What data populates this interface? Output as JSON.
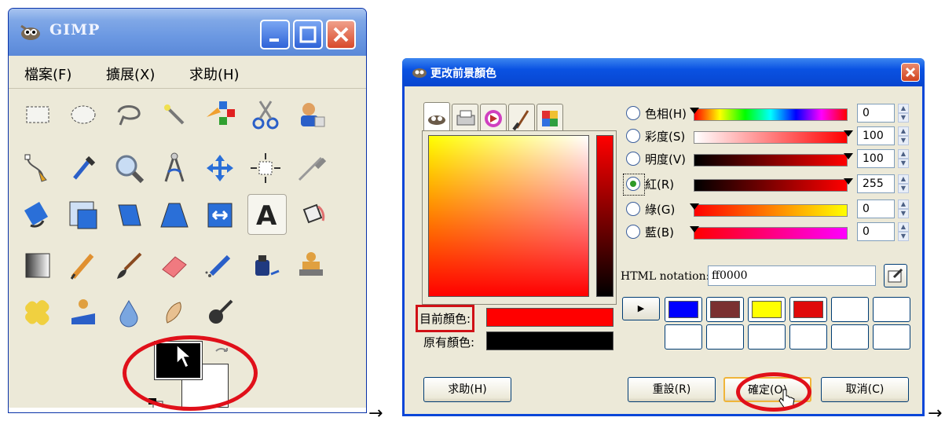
{
  "toolbox": {
    "title": "GIMP",
    "menu": [
      "檔案(F)",
      "擴展(X)",
      "求助(H)"
    ],
    "window_buttons": [
      "minimize-icon",
      "maximize-icon",
      "close-icon"
    ]
  },
  "dialog": {
    "title": "更改前景顏色",
    "tabs": [
      "gimp-selector-icon",
      "cmyk-printer-icon",
      "triangle-wheel-icon",
      "watercolor-brush-icon",
      "scales-icon"
    ],
    "channels": [
      {
        "label": "色相(H)",
        "value": "0",
        "selected": false
      },
      {
        "label": "彩度(S)",
        "value": "100",
        "selected": false
      },
      {
        "label": "明度(V)",
        "value": "100",
        "selected": false
      },
      {
        "label": "紅(R)",
        "value": "255",
        "selected": true
      },
      {
        "label": "綠(G)",
        "value": "0",
        "selected": false
      },
      {
        "label": "藍(B)",
        "value": "0",
        "selected": false
      }
    ],
    "current_color_label": "目前顏色:",
    "old_color_label": "原有顏色:",
    "current_color": "#ff0000",
    "old_color": "#000000",
    "html_notation_label": "HTML notation:",
    "html_notation_value": "ff0000",
    "history_colors": [
      "#0000ff",
      "#7a3030",
      "#ffff00",
      "#e00a0a",
      "#ffffff",
      "#ffffff",
      "#ffffff",
      "#ffffff",
      "#ffffff",
      "#ffffff",
      "#ffffff",
      "#ffffff"
    ],
    "buttons": {
      "help": "求助(H)",
      "reset": "重設(R)",
      "ok": "確定(O)",
      "cancel": "取消(C)"
    }
  },
  "colors": {
    "highlight_red": "#e0101a",
    "xp_blue": "#0a46d8"
  }
}
